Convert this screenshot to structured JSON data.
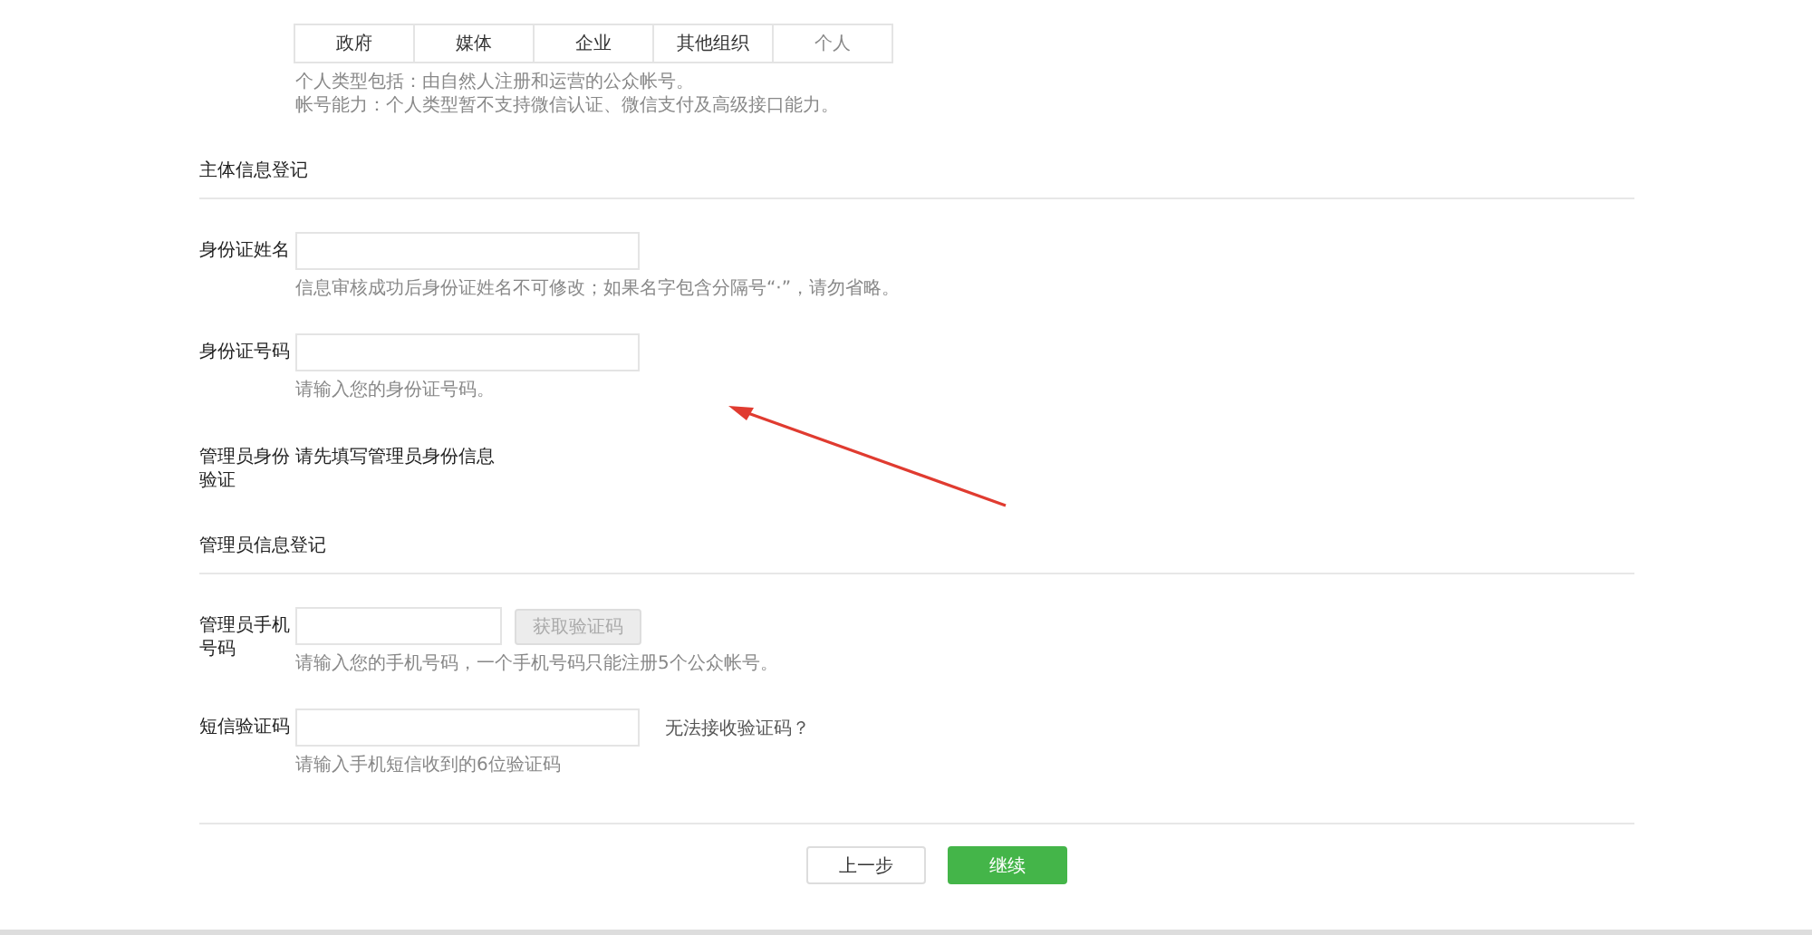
{
  "type_tabs": [
    {
      "label": "政府",
      "selected": false
    },
    {
      "label": "媒体",
      "selected": false
    },
    {
      "label": "企业",
      "selected": false
    },
    {
      "label": "其他组织",
      "selected": false
    },
    {
      "label": "个人",
      "selected": true
    }
  ],
  "type_notes": [
    "个人类型包括：由自然人注册和运营的公众帐号。",
    "帐号能力：个人类型暂不支持微信认证、微信支付及高级接口能力。"
  ],
  "sections": [
    {
      "title": "主体信息登记",
      "fields": [
        {
          "kind": "input",
          "label": "身份证姓名",
          "hint": "信息审核成功后身份证姓名不可修改；如果名字包含分隔号“·”，请勿省略。"
        },
        {
          "kind": "input",
          "label": "身份证号码",
          "hint": "请输入您的身份证号码。"
        },
        {
          "kind": "text",
          "label": "管理员身份验证",
          "value": "请先填写管理员身份信息"
        }
      ]
    },
    {
      "title": "管理员信息登记",
      "fields": [
        {
          "kind": "input-button",
          "label": "管理员手机号码",
          "button": "获取验证码",
          "disabled": true,
          "hint": "请输入您的手机号码，一个手机号码只能注册5个公众帐号。"
        },
        {
          "kind": "input-link",
          "label": "短信验证码",
          "link": "无法接收验证码？",
          "hint": "请输入手机短信收到的6位验证码"
        }
      ]
    }
  ],
  "buttons": [
    {
      "label": "上一步",
      "kind": "secondary"
    },
    {
      "label": "继续",
      "kind": "primary"
    }
  ]
}
